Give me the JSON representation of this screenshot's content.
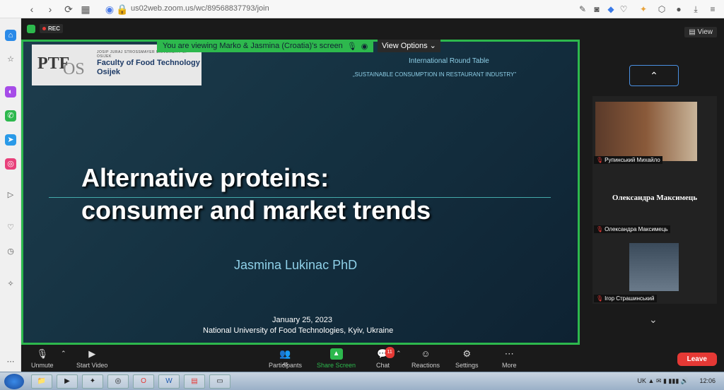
{
  "browser": {
    "url": "us02web.zoom.us/wc/89568837793/join",
    "back_icon": "back-icon",
    "forward_icon": "forward-icon",
    "reload_icon": "reload-icon"
  },
  "zoom": {
    "rec_label": "REC",
    "view_label": "View",
    "viewing_banner": "You are viewing Marko & Jasmina (Croatia)'s screen",
    "view_options": "View Options"
  },
  "slide": {
    "logo_ptf": "PTF",
    "logo_os": "OS",
    "logo_university": "JOSIP JURAJ STROSSMAYER UNIVERSITY OF OSIJEK",
    "logo_faculty": "Faculty of Food Technology",
    "logo_city": "Osijek",
    "event": "International Round Table",
    "conference": "„SUSTAINABLE CONSUMPTION IN RESTAURANT INDUSTRY”",
    "title_line1": "Alternative proteins:",
    "title_line2": "consumer and market trends",
    "author": "Jasmina Lukinac PhD",
    "date": "January 25, 2023",
    "venue": "National University of Food Technologies, Kyiv, Ukraine"
  },
  "participants_panel": {
    "tiles": [
      {
        "name": "Рупинський Михайло"
      },
      {
        "name": "Олександра Максимець",
        "display_name": "Олександра Максимець"
      },
      {
        "name": "Ігор Страшинський"
      }
    ]
  },
  "toolbar": {
    "unmute": "Unmute",
    "start_video": "Start Video",
    "participants": "Participants",
    "participants_count": "45",
    "share_screen": "Share Screen",
    "chat": "Chat",
    "chat_badge": "11",
    "reactions": "Reactions",
    "settings": "Settings",
    "more": "More",
    "leave": "Leave"
  },
  "taskbar": {
    "lang": "UK",
    "clock": "12:06"
  },
  "colors": {
    "accent_green": "#2db84d",
    "leave_red": "#e53935",
    "slide_text": "#8fd0e8"
  }
}
